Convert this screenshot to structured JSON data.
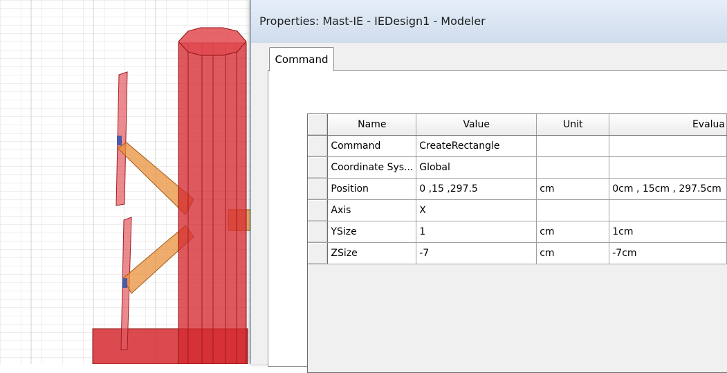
{
  "dialog": {
    "title": "Properties: Mast-IE - IEDesign1 - Modeler",
    "tabs": [
      {
        "label": "Command",
        "active": true
      }
    ]
  },
  "grid": {
    "headers": [
      "Name",
      "Value",
      "Unit",
      "Evalua"
    ],
    "rows": [
      {
        "name": "Command",
        "value": "CreateRectangle",
        "unit": "",
        "evaluated": ""
      },
      {
        "name": "Coordinate Sys...",
        "value": "Global",
        "unit": "",
        "evaluated": ""
      },
      {
        "name": "Position",
        "value": "0 ,15 ,297.5",
        "unit": "cm",
        "evaluated": "0cm , 15cm , 297.5cm"
      },
      {
        "name": "Axis",
        "value": "X",
        "unit": "",
        "evaluated": ""
      },
      {
        "name": "YSize",
        "value": "1",
        "unit": "cm",
        "evaluated": "1cm"
      },
      {
        "name": "ZSize",
        "value": "-7",
        "unit": "cm",
        "evaluated": "-7cm"
      }
    ]
  },
  "colors": {
    "mast": "#d42a2f",
    "arms": "#e8913b",
    "titlebar": "#dbe6f3"
  }
}
